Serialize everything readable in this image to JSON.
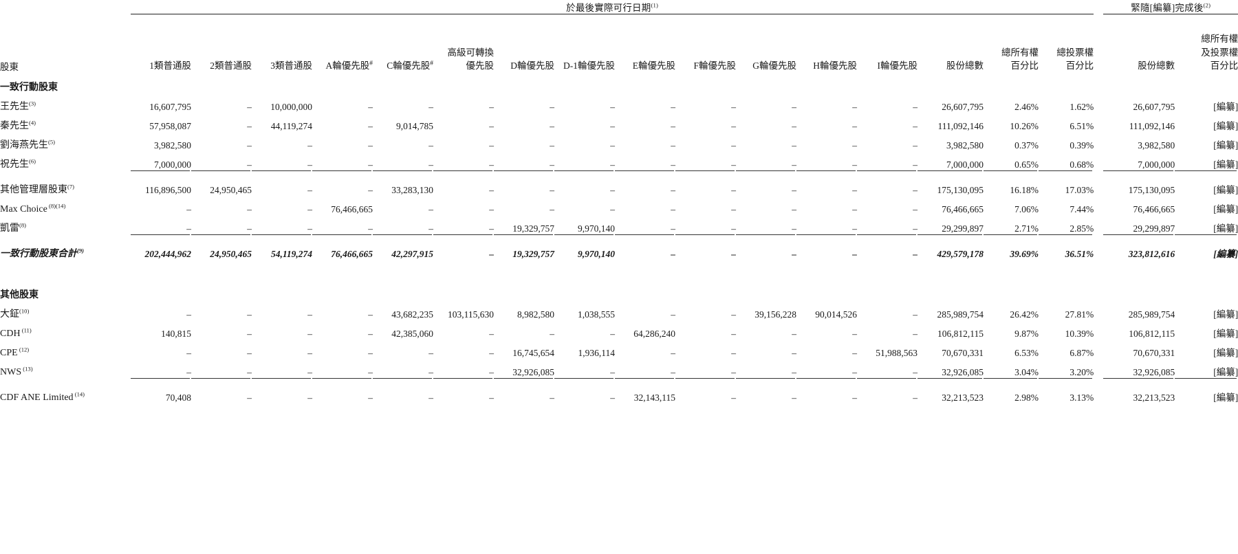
{
  "header": {
    "group_left": "於最後實際可行日期",
    "group_left_note": "(1)",
    "group_right": "緊隨[編纂]完成後",
    "group_right_note": "(2)",
    "row_label": "股東",
    "columns": [
      {
        "lines": [
          "1類普通股"
        ]
      },
      {
        "lines": [
          "2類普通股"
        ]
      },
      {
        "lines": [
          "3類普通股"
        ]
      },
      {
        "lines": [
          "A輪優先股"
        ],
        "mark": "#"
      },
      {
        "lines": [
          "C輪優先股"
        ],
        "mark": "#"
      },
      {
        "lines": [
          "高級可轉換",
          "優先股"
        ]
      },
      {
        "lines": [
          "D輪優先股"
        ]
      },
      {
        "lines": [
          "D-1輪優先股"
        ]
      },
      {
        "lines": [
          "E輪優先股"
        ]
      },
      {
        "lines": [
          "F輪優先股"
        ]
      },
      {
        "lines": [
          "G輪優先股"
        ]
      },
      {
        "lines": [
          "H輪優先股"
        ]
      },
      {
        "lines": [
          "I輪優先股"
        ]
      },
      {
        "lines": [
          "股份總數"
        ]
      },
      {
        "lines": [
          "總所有權",
          "百分比"
        ]
      },
      {
        "lines": [
          "總投票權",
          "百分比"
        ]
      },
      {
        "lines": [
          "股份總數"
        ]
      },
      {
        "lines": [
          "總所有權",
          "及投票權",
          "百分比"
        ]
      }
    ]
  },
  "sections": [
    {
      "title": "一致行動股東",
      "rows": [
        {
          "label": "王先生",
          "note": "(3)",
          "values": [
            "16,607,795",
            "–",
            "10,000,000",
            "–",
            "–",
            "–",
            "–",
            "–",
            "–",
            "–",
            "–",
            "–",
            "–",
            "26,607,795",
            "2.46%",
            "1.62%",
            "26,607,795",
            "[編纂]"
          ]
        },
        {
          "label": "秦先生",
          "note": "(4)",
          "values": [
            "57,958,087",
            "–",
            "44,119,274",
            "–",
            "9,014,785",
            "–",
            "–",
            "–",
            "–",
            "–",
            "–",
            "–",
            "–",
            "111,092,146",
            "10.26%",
            "6.51%",
            "111,092,146",
            "[編纂]"
          ]
        },
        {
          "label": "劉海燕先生",
          "note": "(5)",
          "values": [
            "3,982,580",
            "–",
            "–",
            "–",
            "–",
            "–",
            "–",
            "–",
            "–",
            "–",
            "–",
            "–",
            "–",
            "3,982,580",
            "0.37%",
            "0.39%",
            "3,982,580",
            "[編纂]"
          ]
        },
        {
          "label": "祝先生",
          "note": "(6)",
          "values": [
            "7,000,000",
            "–",
            "–",
            "–",
            "–",
            "–",
            "–",
            "–",
            "–",
            "–",
            "–",
            "–",
            "–",
            "7,000,000",
            "0.65%",
            "0.68%",
            "7,000,000",
            "[編纂]"
          ]
        },
        {
          "rule": true
        },
        {
          "label": "其他管理層股東",
          "note": "(7)",
          "values": [
            "116,896,500",
            "24,950,465",
            "–",
            "–",
            "33,283,130",
            "–",
            "–",
            "–",
            "–",
            "–",
            "–",
            "–",
            "–",
            "175,130,095",
            "16.18%",
            "17.03%",
            "175,130,095",
            "[編纂]"
          ]
        },
        {
          "label": "Max Choice",
          "note": "(8)(14)",
          "latin": true,
          "values": [
            "–",
            "–",
            "–",
            "76,466,665",
            "–",
            "–",
            "–",
            "–",
            "–",
            "–",
            "–",
            "–",
            "–",
            "76,466,665",
            "7.06%",
            "7.44%",
            "76,466,665",
            "[編纂]"
          ]
        },
        {
          "label": "凱雷",
          "note": "(8)",
          "values": [
            "–",
            "–",
            "–",
            "–",
            "–",
            "–",
            "19,329,757",
            "9,970,140",
            "–",
            "–",
            "–",
            "–",
            "–",
            "29,299,897",
            "2.71%",
            "2.85%",
            "29,299,897",
            "[編纂]"
          ]
        },
        {
          "label": "一致行動股東合計",
          "note": "(9)",
          "italic": true,
          "rule_above": true,
          "values": [
            "202,444,962",
            "24,950,465",
            "54,119,274",
            "76,466,665",
            "42,297,915",
            "–",
            "19,329,757",
            "9,970,140",
            "–",
            "–",
            "–",
            "–",
            "–",
            "429,579,178",
            "39.69%",
            "36.51%",
            "323,812,616",
            "[編纂]"
          ]
        }
      ]
    },
    {
      "title": "其他股東",
      "rows": [
        {
          "label": "大鉦",
          "note": "(10)",
          "values": [
            "–",
            "–",
            "–",
            "–",
            "43,682,235",
            "103,115,630",
            "8,982,580",
            "1,038,555",
            "–",
            "–",
            "39,156,228",
            "90,014,526",
            "–",
            "285,989,754",
            "26.42%",
            "27.81%",
            "285,989,754",
            "[編纂]"
          ]
        },
        {
          "label": "CDH",
          "note": "(11)",
          "latin": true,
          "values": [
            "140,815",
            "–",
            "–",
            "–",
            "42,385,060",
            "–",
            "–",
            "–",
            "64,286,240",
            "–",
            "–",
            "–",
            "–",
            "106,812,115",
            "9.87%",
            "10.39%",
            "106,812,115",
            "[編纂]"
          ]
        },
        {
          "label": "CPE",
          "note": "(12)",
          "latin": true,
          "values": [
            "–",
            "–",
            "–",
            "–",
            "–",
            "–",
            "16,745,654",
            "1,936,114",
            "–",
            "–",
            "–",
            "–",
            "51,988,563",
            "70,670,331",
            "6.53%",
            "6.87%",
            "70,670,331",
            "[編纂]"
          ]
        },
        {
          "label": "NWS",
          "note": "(13)",
          "latin": true,
          "values": [
            "–",
            "–",
            "–",
            "–",
            "–",
            "–",
            "32,926,085",
            "–",
            "–",
            "–",
            "–",
            "–",
            "–",
            "32,926,085",
            "3.04%",
            "3.20%",
            "32,926,085",
            "[編纂]"
          ]
        },
        {
          "rule": true
        },
        {
          "label": "CDF ANE Limited",
          "note": "(14)",
          "latin": true,
          "values": [
            "70,408",
            "–",
            "–",
            "–",
            "–",
            "–",
            "–",
            "–",
            "32,143,115",
            "–",
            "–",
            "–",
            "–",
            "32,213,523",
            "2.98%",
            "3.13%",
            "32,213,523",
            "[編纂]"
          ]
        }
      ]
    }
  ]
}
